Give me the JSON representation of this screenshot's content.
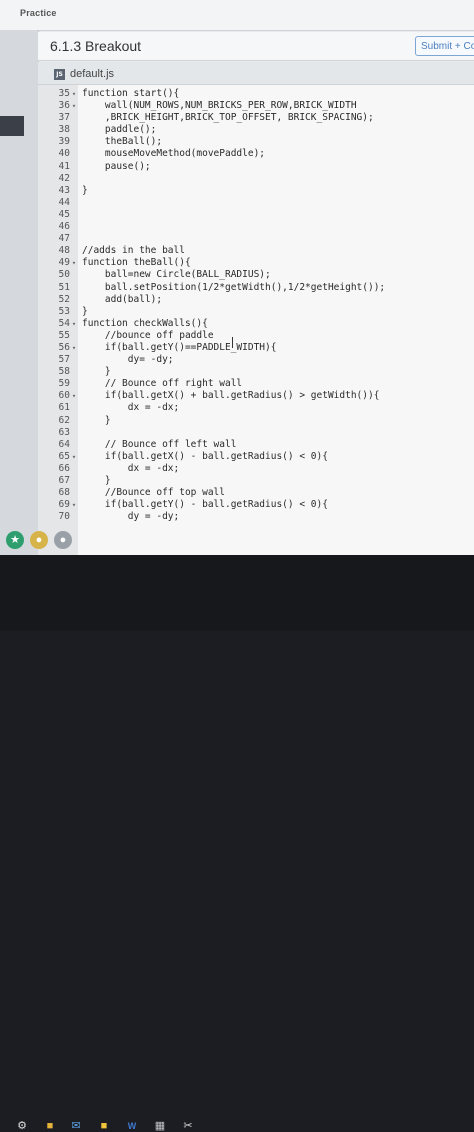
{
  "app": {
    "brand": "Practice"
  },
  "lesson": {
    "title": "6.1.3 Breakout",
    "submit_label": "Submit + Co"
  },
  "file_tab": {
    "icon": "js-file-icon",
    "icon_text": "JS",
    "name": "default.js"
  },
  "code": {
    "lines": [
      {
        "num": "35",
        "fold": "▾",
        "text": "function start(){"
      },
      {
        "num": "36",
        "fold": "▾",
        "text": "    wall(NUM_ROWS,NUM_BRICKS_PER_ROW,BRICK_WIDTH"
      },
      {
        "num": "37",
        "fold": "",
        "text": "    ,BRICK_HEIGHT,BRICK_TOP_OFFSET, BRICK_SPACING);"
      },
      {
        "num": "38",
        "fold": "",
        "text": "    paddle();"
      },
      {
        "num": "39",
        "fold": "",
        "text": "    theBall();"
      },
      {
        "num": "40",
        "fold": "",
        "text": "    mouseMoveMethod(movePaddle);"
      },
      {
        "num": "41",
        "fold": "",
        "text": "    pause();"
      },
      {
        "num": "42",
        "fold": "",
        "text": ""
      },
      {
        "num": "43",
        "fold": "",
        "text": "}"
      },
      {
        "num": "44",
        "fold": "",
        "text": ""
      },
      {
        "num": "45",
        "fold": "",
        "text": ""
      },
      {
        "num": "46",
        "fold": "",
        "text": ""
      },
      {
        "num": "47",
        "fold": "",
        "text": ""
      },
      {
        "num": "48",
        "fold": "",
        "text": "//adds in the ball"
      },
      {
        "num": "49",
        "fold": "▾",
        "text": "function theBall(){"
      },
      {
        "num": "50",
        "fold": "",
        "text": "    ball=new Circle(BALL_RADIUS);"
      },
      {
        "num": "51",
        "fold": "",
        "text": "    ball.setPosition(1/2*getWidth(),1/2*getHeight());"
      },
      {
        "num": "52",
        "fold": "",
        "text": "    add(ball);"
      },
      {
        "num": "53",
        "fold": "",
        "text": "}"
      },
      {
        "num": "54",
        "fold": "▾",
        "text": "function checkWalls(){"
      },
      {
        "num": "55",
        "fold": "",
        "text": "    //bounce off paddle"
      },
      {
        "num": "56",
        "fold": "▾",
        "text": "    if(ball.getY()==PADDLE_WIDTH){"
      },
      {
        "num": "57",
        "fold": "",
        "text": "        dy= -dy;"
      },
      {
        "num": "58",
        "fold": "",
        "text": "    }"
      },
      {
        "num": "59",
        "fold": "",
        "text": "    // Bounce off right wall"
      },
      {
        "num": "60",
        "fold": "▾",
        "text": "    if(ball.getX() + ball.getRadius() > getWidth()){"
      },
      {
        "num": "61",
        "fold": "",
        "text": "        dx = -dx;"
      },
      {
        "num": "62",
        "fold": "",
        "text": "    }"
      },
      {
        "num": "63",
        "fold": "",
        "text": ""
      },
      {
        "num": "64",
        "fold": "",
        "text": "    // Bounce off left wall"
      },
      {
        "num": "65",
        "fold": "▾",
        "text": "    if(ball.getX() - ball.getRadius() < 0){"
      },
      {
        "num": "66",
        "fold": "",
        "text": "        dx = -dx;"
      },
      {
        "num": "67",
        "fold": "",
        "text": "    }"
      },
      {
        "num": "68",
        "fold": "",
        "text": "    //Bounce off top wall"
      },
      {
        "num": "69",
        "fold": "▾",
        "text": "    if(ball.getY() - ball.getRadius() < 0){"
      },
      {
        "num": "70",
        "fold": "",
        "text": "        dy = -dy;"
      }
    ]
  },
  "colors": {
    "accent": "#4c7fbf",
    "editor_bg": "#f7f7f7",
    "gutter_bg": "#e4e6e8",
    "taskbar": "#17181c"
  },
  "taskbar": {
    "icons": [
      "gear-icon",
      "file-explorer-icon",
      "mail-icon",
      "sticky-notes-icon",
      "word-icon",
      "calculator-icon",
      "snipping-tool-icon"
    ]
  }
}
